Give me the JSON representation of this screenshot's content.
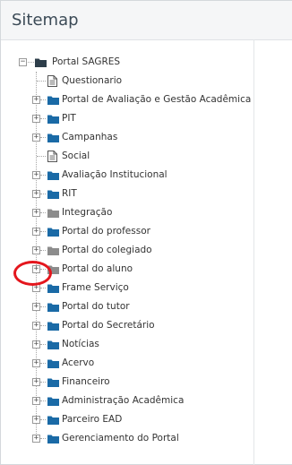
{
  "panel": {
    "title": "Sitemap"
  },
  "tree": {
    "root": {
      "label": "Portal SAGRES",
      "expanded": true
    },
    "items": [
      {
        "label": "Questionario",
        "kind": "page",
        "expandable": false
      },
      {
        "label": "Portal de Avaliação e Gestão Acadêmica",
        "kind": "folder",
        "expandable": true
      },
      {
        "label": "PIT",
        "kind": "folder",
        "expandable": true
      },
      {
        "label": "Campanhas",
        "kind": "folder",
        "expandable": true
      },
      {
        "label": "Social",
        "kind": "page",
        "expandable": false
      },
      {
        "label": "Avaliação Institucional",
        "kind": "folder",
        "expandable": true
      },
      {
        "label": "RIT",
        "kind": "folder",
        "expandable": true
      },
      {
        "label": "Integração",
        "kind": "folder-gray",
        "expandable": true
      },
      {
        "label": "Portal do professor",
        "kind": "folder",
        "expandable": true
      },
      {
        "label": "Portal do colegiado",
        "kind": "folder-gray",
        "expandable": true
      },
      {
        "label": "Portal do aluno",
        "kind": "folder-gray",
        "expandable": true
      },
      {
        "label": "Frame Serviço",
        "kind": "folder",
        "expandable": true
      },
      {
        "label": "Portal do tutor",
        "kind": "folder",
        "expandable": true
      },
      {
        "label": "Portal do Secretário",
        "kind": "folder",
        "expandable": true
      },
      {
        "label": "Notícias",
        "kind": "folder",
        "expandable": true
      },
      {
        "label": "Acervo",
        "kind": "folder",
        "expandable": true
      },
      {
        "label": "Financeiro",
        "kind": "folder",
        "expandable": true
      },
      {
        "label": "Administração Acadêmica",
        "kind": "folder",
        "expandable": true
      },
      {
        "label": "Parceiro EAD",
        "kind": "folder",
        "expandable": true
      },
      {
        "label": "Gerenciamento do Portal",
        "kind": "folder",
        "expandable": true
      }
    ]
  },
  "icons": {
    "root": "folder-dark-icon",
    "folder": "folder-icon",
    "folder-gray": "folder-gray-icon",
    "page": "page-icon",
    "expand": "plus-icon",
    "collapse": "minus-icon"
  },
  "colors": {
    "folder": "#1a6aa6",
    "folder_gray": "#8c8c8c",
    "folder_dark": "#2d3e4a",
    "highlight_circle": "#e4161d"
  },
  "annotation": {
    "highlighted_item": "Portal do aluno"
  }
}
